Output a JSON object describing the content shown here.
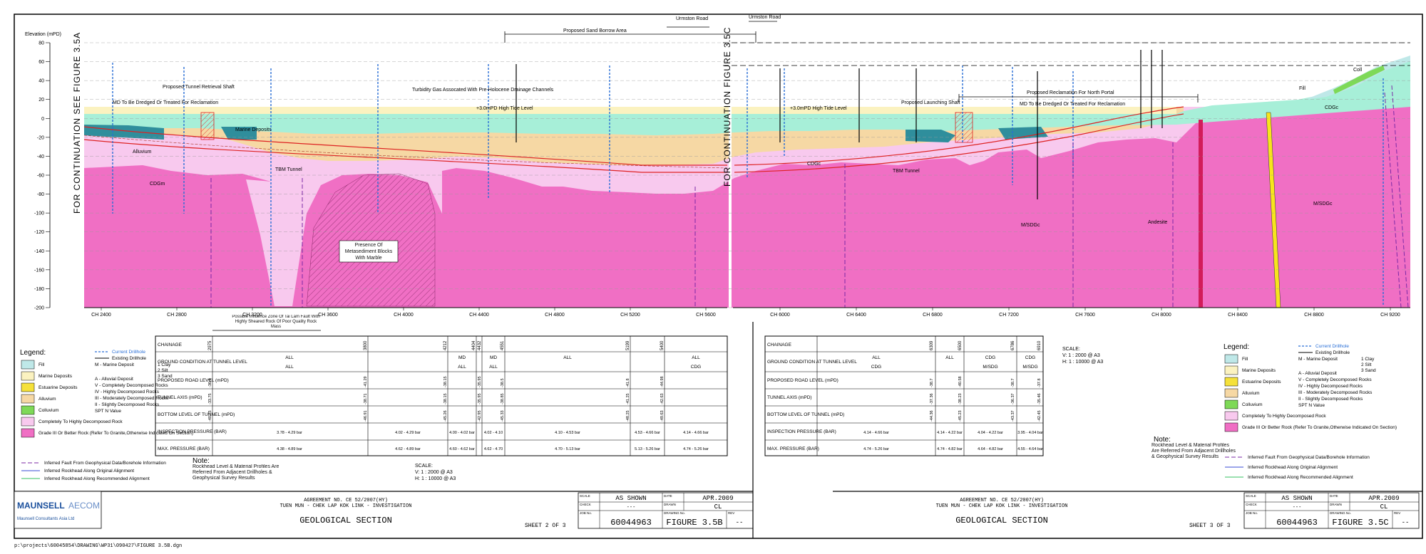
{
  "header": {
    "elevation_label": "Elevation (mPD)",
    "continuation_left": "FOR CONTINUATION SEE FIGURE 3.5A",
    "continuation_mid": "FOR CONTINUATION FIGURE 3.5C",
    "y_ticks": [
      "80",
      "60",
      "40",
      "20",
      "0",
      "-20",
      "-40",
      "-60",
      "-80",
      "-100",
      "-120",
      "-140",
      "-160",
      "-180",
      "-200"
    ],
    "chainage_left": [
      "CH 2400",
      "CH 2800",
      "CH 3200",
      "CH 3600",
      "CH 4000",
      "CH 4400",
      "CH 4800",
      "CH 5200",
      "CH 5600"
    ],
    "chainage_right": [
      "CH 6000",
      "CH 6400",
      "CH 6800",
      "CH 7200",
      "CH 7600",
      "CH 8000",
      "CH 8400",
      "CH 8800",
      "CH 9200"
    ]
  },
  "annotations": {
    "urmston_road_1": "Urmston Road",
    "urmston_road_2": "Urmston Road",
    "sand_borrow": "Proposed Sand Borrow Area",
    "md_dredged_left": "MD To Be Dredged Or Treated For Reclamation",
    "tunnel_retrieval": "Proposed Tunnel Retrieval Shaft",
    "turbidity": "Turbidity Gas Assocated With Pre-Holocene Drainage Channels",
    "high_tide_left": "+3.0mPD  High Tide Level",
    "high_tide_right": "+3.0mPD  High Tide Level",
    "marine_deposits": "Marine Deposits",
    "alluvium": "Alluvium",
    "tbm_left": "TBM Tunnel",
    "tbm_right": "TBM Tunnel",
    "cdgm": "CDGm",
    "cdgc": "CDGc",
    "cdgc_right": "CDGc",
    "metasediment": "Presence Of Metasediment Blocks With Marble",
    "launching_shaft": "Proposed Launching Shaft",
    "md_dredged_right": "MD To Be Dredged Or Treated For Reclamation",
    "reclamation_north": "Proposed Reclamation For North Portal",
    "fill": "Fill",
    "coll": "Coll",
    "msdgc_1": "M/SDGc",
    "msdgc_2": "M/SDGc",
    "andesite": "Andesite",
    "influence_zone": "Possible Influence Zone Of Tai Lam Fault With Highly Sheared Rock Of Poor Quality Rock Mass"
  },
  "table_left": {
    "labels": [
      "CHAINAGE",
      "GROUND CONDITION AT TUNNEL LEVEL",
      "PROPOSED ROAD LEVEL (mPD)",
      "TUNNEL AXIS (mPD)",
      "BOTTOM LEVEL OF TUNNEL (mPD)",
      "INSPECTION PRESSURE (BAR)",
      "MAX. PRESSURE (BAR)"
    ],
    "chainage_values": [
      "2975",
      "3800",
      "4212",
      "4404",
      "4432",
      "4551",
      "5199",
      "5400"
    ],
    "ground_top": [
      "ALL",
      "MD",
      "MD",
      "ALL"
    ],
    "ground_bottom": [
      "ALL",
      "ALL",
      "ALL",
      "CDG"
    ],
    "road_values": [
      "-36.1",
      "-41.29",
      "-38.15",
      "-35.95",
      "-38.5",
      "-41.8",
      "-44.98"
    ],
    "axis_values": [
      "-33.75",
      "-38.71",
      "-38.15",
      "-35.95",
      "-38.85",
      "-41.25",
      "-42.63"
    ],
    "bottom_values": [
      "-40.75",
      "-46.91",
      "-45.26",
      "-42.95",
      "-45.33",
      "-48.25",
      "-49.63"
    ],
    "inspection": [
      "3.78 - 4.29 bar",
      "4.02 - 4.29 bar",
      "4.00 - 4.02 bar",
      "4.02 - 4.10",
      "4.10 - 4.53 bar",
      "4.53 - 4.66 bar",
      "4.14 - 4.66 bar"
    ],
    "max_pressure": [
      "4.38 - 4.89 bar",
      "4.62 - 4.89 bar",
      "4.60 - 4.62 bar",
      "4.62 - 4.70",
      "4.70 - 5.13 bar",
      "5.13 - 5.26 bar",
      "4.74 - 5.26 bar"
    ]
  },
  "table_right": {
    "chainage_values": [
      "6309",
      "6500",
      "6786",
      "6910"
    ],
    "ground_top": [
      "ALL",
      "ALL",
      "CDG",
      "CDG"
    ],
    "ground_bottom": [
      "CDG",
      "M/SDG",
      "M/SDG"
    ],
    "road_values": [
      "-38.7",
      "-40.58",
      "-38.7",
      "-37.8"
    ],
    "axis_values": [
      "-37.36",
      "-38.23",
      "-36.37",
      "-35.46"
    ],
    "bottom_values": [
      "-44.36",
      "-45.23",
      "-43.37",
      "-42.45"
    ],
    "inspection": [
      "4.14 - 4.66 bar",
      "4.14 - 4.22 bar",
      "4.04 - 4.22 bar",
      "3.95 - 4.04 bar"
    ],
    "max_pressure": [
      "4.74 - 5.26 bar",
      "4.74 - 4.82 bar",
      "4.64 - 4.82 bar",
      "4.55 - 4.64 bar"
    ]
  },
  "legend": {
    "title": "Legend:",
    "items": [
      {
        "label": "Fill",
        "color": "#bfe8e8"
      },
      {
        "label": "Marine Deposits",
        "color": "#fbf2c0"
      },
      {
        "label": "Estuarine Deposits",
        "color": "#f5e13a"
      },
      {
        "label": "Alluvium",
        "color": "#f6d8a4"
      },
      {
        "label": "Colluvium",
        "color": "#7ed957"
      },
      {
        "label": "Completely To Highly Decomposed Rock",
        "color": "#f8c9ee"
      },
      {
        "label": "Grade III Or Better Rock (Refer To Granite,Otherwise Indicated On Section)",
        "color": "#f06fc4"
      }
    ],
    "drillhole_current": "Current Drillhole",
    "drillhole_existing": "Existing Drillhole",
    "codes": [
      "M - Marine Deposit",
      "A - Alluvial Deposit",
      "V - Completely Decomposed Rocks",
      "IV - Highly Decomposed Rocks",
      "III - Moderately Decomposed Rocks",
      "II - Slightly Decomposed Rocks",
      "SPT N Value"
    ],
    "sub_codes": [
      "1 Clay",
      "2 Silt",
      "3 Sand"
    ],
    "lines": [
      "Inferred Fault From Geophysical Data/Borehole Information",
      "Inferred Rockhead Along Original Alignment",
      "Inferred Rockhead Along Recommended Alignment"
    ]
  },
  "notes": {
    "title": "Note:",
    "text": "Rockhead Level & Material Profiles Are Referred From Adjacent Drillholes & Geophysical Survey Results"
  },
  "scale": {
    "title": "SCALE:",
    "v": "V: 1 : 2000 @ A3",
    "h": "H: 1 : 10000 @ A3"
  },
  "titleblock_left": {
    "company": "MAUNSELL",
    "company2": "AECOM",
    "company_sub": "Maunsell Consultants Asia Ltd",
    "agreement": "AGREEMENT NO. CE 52/2007(HY)",
    "project": "TUEN MUN - CHEK LAP KOK LINK - INVESTIGATION",
    "title": "GEOLOGICAL SECTION",
    "sheet": "SHEET 2 OF 3",
    "scale_val": "AS SHOWN",
    "date_val": "APR.2009",
    "check_val": "---",
    "drawn_val": "CL",
    "job_no": "60044963",
    "drawing_no": "FIGURE 3.5B",
    "rev": "--"
  },
  "titleblock_right": {
    "agreement": "AGREEMENT NO. CE 52/2007(HY)",
    "project": "TUEN MUN - CHEK LAP KOK LINK - INVESTIGATION",
    "title": "GEOLOGICAL SECTION",
    "sheet": "SHEET 3 OF 3",
    "scale_val": "AS SHOWN",
    "date_val": "APR.2009",
    "check_val": "---",
    "drawn_val": "CL",
    "job_no": "60044963",
    "drawing_no": "FIGURE 3.5C",
    "rev": "--"
  },
  "titleblock_labels": {
    "scale": "SCALE",
    "date": "DATE",
    "check": "CHECK",
    "drawn": "DRAWN",
    "job": "JOB No.",
    "drawing": "DRAWING No.",
    "rev": "REV"
  },
  "file_path": "p:\\projects\\60045854\\DRAWING\\WP31\\090427\\FIGURE 3.5B.dgn"
}
